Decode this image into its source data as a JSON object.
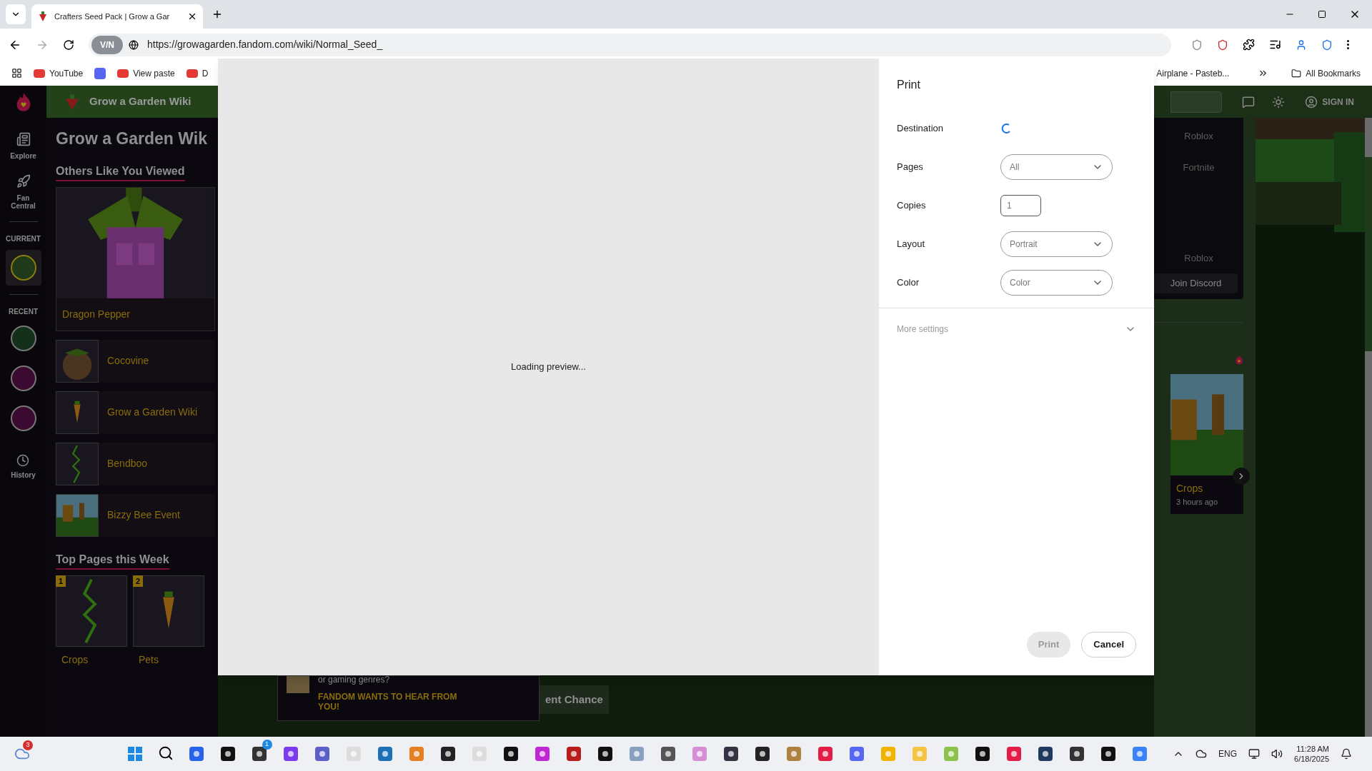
{
  "browser": {
    "tab": {
      "title": "Crafters Seed Pack | Grow a Gar"
    },
    "address": {
      "vpn_badge": "V/N",
      "url": "https://growagarden.fandom.com/wiki/Normal_Seed_"
    },
    "bookmarks": [
      {
        "kind": "labeled",
        "label": "YouTube"
      },
      {
        "kind": "icon"
      },
      {
        "kind": "labeled",
        "label": "View paste"
      },
      {
        "kind": "labeled",
        "label": "D"
      }
    ],
    "bookmarks_right": {
      "label": "Airplane - Pasteb...",
      "all": "All Bookmarks"
    }
  },
  "wiki": {
    "header_title": "Grow a Garden Wiki",
    "page_title": "Grow a Garden Wik",
    "rail": {
      "items": [
        {
          "kind": "explore",
          "label": "Explore"
        },
        {
          "kind": "fan",
          "label": "Fan Central"
        }
      ],
      "current_label": "CURRENT",
      "recent_label": "RECENT",
      "history_label": "History"
    },
    "others_heading": "Others Like You Viewed",
    "featured": {
      "title": "Dragon Pepper"
    },
    "others": [
      {
        "title": "Cocovine"
      },
      {
        "title": "Grow a Garden Wiki"
      },
      {
        "title": "Bendboo"
      },
      {
        "title": "Bizzy Bee Event"
      }
    ],
    "top_heading": "Top Pages this Week",
    "top_pages": [
      {
        "rank": "1",
        "title": "Crops"
      },
      {
        "rank": "2",
        "title": "Pets"
      }
    ],
    "sign_in": "SIGN IN",
    "sidebar_links": [
      "Roblox",
      "Fortnite",
      "Roblox"
    ],
    "join_button": "Join Discord",
    "recent_card": {
      "title": "Crops",
      "time": "3 hours ago"
    },
    "survey": {
      "question": "or gaming genres?",
      "cta": "FANDOM WANTS TO HEAR FROM YOU!"
    },
    "chance_button": "ent Chance"
  },
  "print_dialog": {
    "title": "Print",
    "preview_text": "Loading preview...",
    "fields": [
      {
        "label": "Destination",
        "kind": "spinner"
      },
      {
        "label": "Pages",
        "kind": "select",
        "value": "All"
      },
      {
        "label": "Copies",
        "kind": "number",
        "value": "1"
      },
      {
        "label": "Layout",
        "kind": "select",
        "value": "Portrait"
      },
      {
        "label": "Color",
        "kind": "select",
        "value": "Color"
      }
    ],
    "more_settings": {
      "label": "More settings",
      "expanded": false
    },
    "buttons": [
      {
        "label": "Print",
        "disabled": true
      },
      {
        "label": "Cancel",
        "disabled": false
      }
    ]
  },
  "taskbar": {
    "weather_badge": "3",
    "app_badge": "1",
    "language": "ENG",
    "time": "11:28 AM",
    "date": "6/18/2025"
  }
}
